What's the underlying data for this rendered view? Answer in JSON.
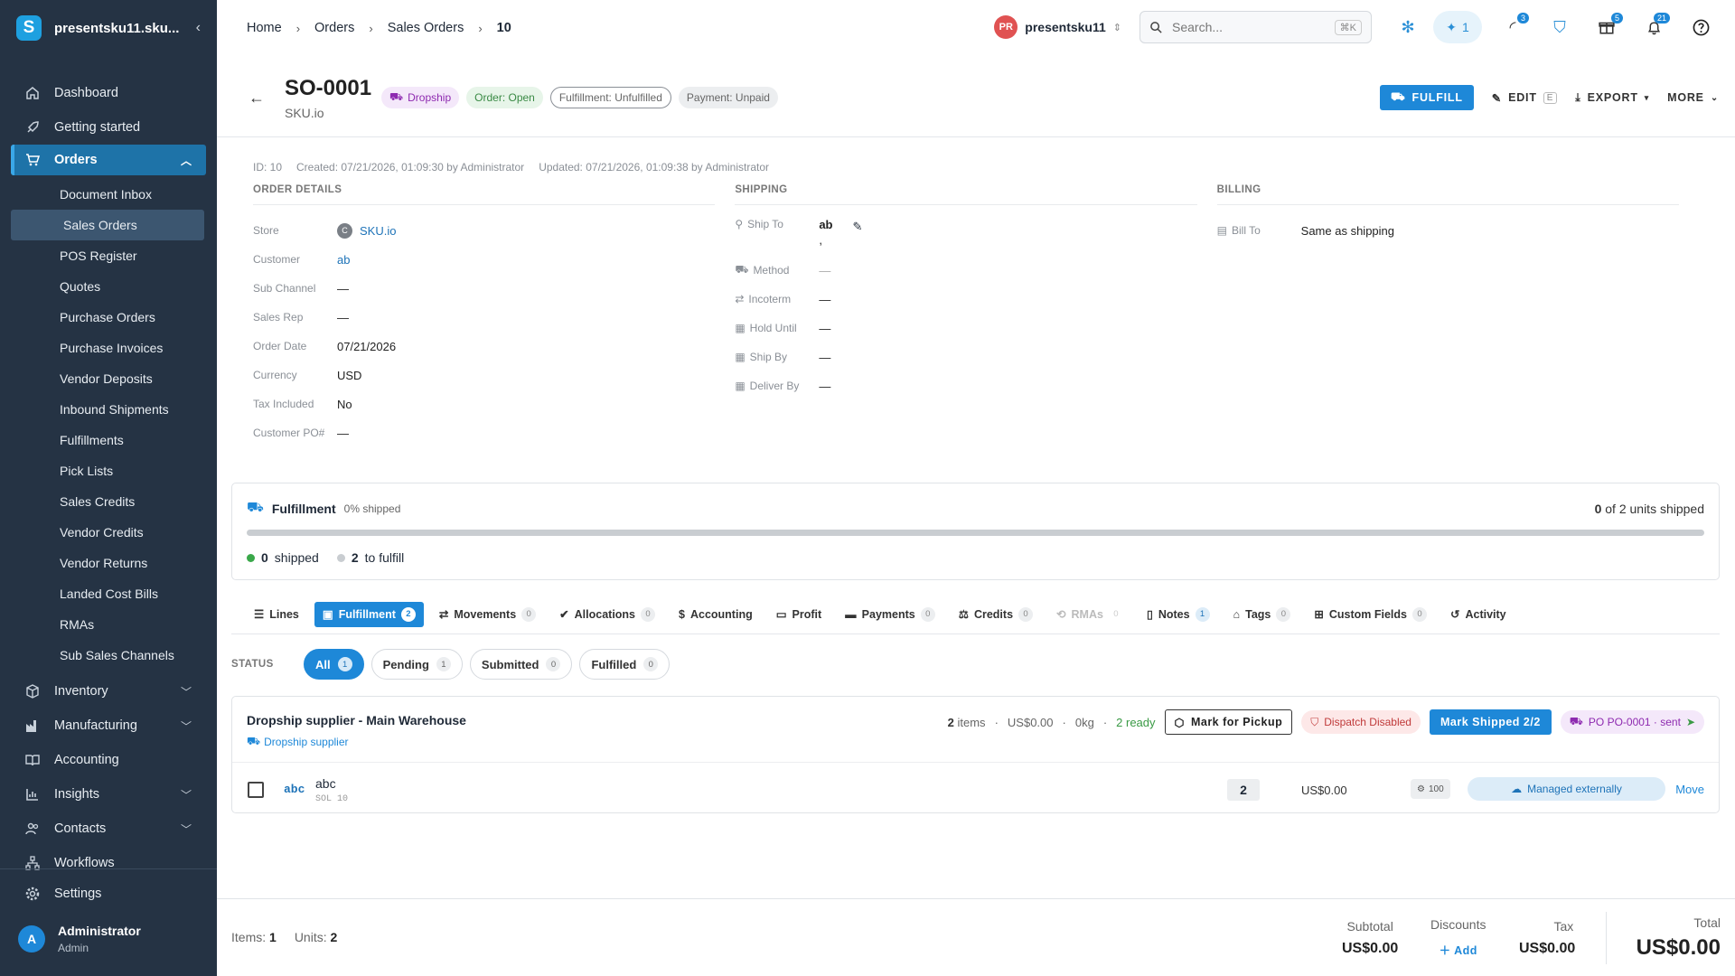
{
  "sidebar": {
    "app_title": "presentsku11.sku...",
    "items": [
      {
        "label": "Dashboard",
        "icon": "home-icon"
      },
      {
        "label": "Getting started",
        "icon": "rocket-icon"
      },
      {
        "label": "Orders",
        "icon": "cart-icon"
      }
    ],
    "order_sub": [
      "Document Inbox",
      "Sales Orders",
      "POS Register",
      "Quotes",
      "Purchase Orders",
      "Purchase Invoices",
      "Vendor Deposits",
      "Inbound Shipments",
      "Fulfillments",
      "Pick Lists",
      "Sales Credits",
      "Vendor Credits",
      "Vendor Returns",
      "Landed Cost Bills",
      "RMAs",
      "Sub Sales Channels"
    ],
    "lower": [
      {
        "label": "Inventory",
        "icon": "box-icon"
      },
      {
        "label": "Manufacturing",
        "icon": "factory-icon"
      },
      {
        "label": "Accounting",
        "icon": "book-icon"
      },
      {
        "label": "Insights",
        "icon": "chart-icon"
      },
      {
        "label": "Contacts",
        "icon": "people-icon"
      },
      {
        "label": "Workflows",
        "icon": "workflow-icon"
      }
    ],
    "settings": "Settings",
    "user": {
      "initial": "A",
      "name": "Administrator",
      "role": "Admin"
    }
  },
  "breadcrumb": [
    "Home",
    "Orders",
    "Sales Orders",
    "10"
  ],
  "topbar": {
    "store_initials": "PR",
    "store_name": "presentsku11",
    "search_placeholder": "Search...",
    "search_shortcut": "⌘K",
    "ai_count": "1",
    "badges": {
      "activity": "3",
      "gifts": "5",
      "notifications": "21"
    }
  },
  "order": {
    "number": "SO-0001",
    "store": "SKU.io",
    "chips": {
      "dropship": "Dropship",
      "order": "Order: Open",
      "fulfillment": "Fulfillment: Unfulfilled",
      "payment": "Payment: Unpaid"
    },
    "actions": {
      "fulfill": "FULFILL",
      "edit": "EDIT",
      "edit_key": "E",
      "export": "EXPORT",
      "more": "MORE"
    },
    "meta": {
      "id": "ID: 10",
      "created": "Created: 07/21/2026, 01:09:30 by Administrator",
      "updated": "Updated: 07/21/2026, 01:09:38 by Administrator"
    }
  },
  "details": {
    "order_header": "ORDER DETAILS",
    "order_rows": [
      {
        "label": "Store",
        "value": "SKU.io"
      },
      {
        "label": "Customer",
        "value": "ab"
      },
      {
        "label": "Sub Channel",
        "value": "—"
      },
      {
        "label": "Sales Rep",
        "value": "—"
      },
      {
        "label": "Order Date",
        "value": "07/21/2026"
      },
      {
        "label": "Currency",
        "value": "USD"
      },
      {
        "label": "Tax Included",
        "value": "No"
      },
      {
        "label": "Customer PO#",
        "value": "—"
      }
    ],
    "store_initial": "C",
    "shipping_header": "SHIPPING",
    "ship_rows": [
      {
        "label": "Ship To",
        "value": "ab",
        "extra": ","
      },
      {
        "label": "Method",
        "value": "—"
      },
      {
        "label": "Incoterm",
        "value": "—"
      },
      {
        "label": "Hold Until",
        "value": "—"
      },
      {
        "label": "Ship By",
        "value": "—"
      },
      {
        "label": "Deliver By",
        "value": "—"
      }
    ],
    "billing_header": "BILLING",
    "bill_label": "Bill To",
    "bill_value": "Same as shipping"
  },
  "fulfillment": {
    "title": "Fulfillment",
    "pct_label": "0% shipped",
    "shipped_fraction": 0,
    "shipped_units": "0",
    "units_suffix": "of 2 units shipped",
    "shipped_count": "0",
    "shipped_label": "shipped",
    "to_fulfill_count": "2",
    "to_fulfill_label": "to fulfill",
    "colors": {
      "shipped": "#3aa84a",
      "to_fulfill": "#c9cdd1"
    }
  },
  "tabs": [
    {
      "label": "Lines",
      "icon": "list-icon"
    },
    {
      "label": "Fulfillment",
      "count": "2",
      "icon": "clipboard-icon",
      "active": true
    },
    {
      "label": "Movements",
      "count": "0",
      "icon": "arrows-icon"
    },
    {
      "label": "Allocations",
      "count": "0",
      "icon": "check-circle-icon"
    },
    {
      "label": "Accounting",
      "icon": "dollar-icon"
    },
    {
      "label": "Profit",
      "icon": "cash-icon"
    },
    {
      "label": "Payments",
      "count": "0",
      "icon": "card-icon"
    },
    {
      "label": "Credits",
      "count": "0",
      "icon": "credit-icon"
    },
    {
      "label": "RMAs",
      "count": "0",
      "icon": "rma-icon",
      "disabled": true
    },
    {
      "label": "Notes",
      "count": "1",
      "icon": "note-icon"
    },
    {
      "label": "Tags",
      "count": "0",
      "icon": "tag-icon"
    },
    {
      "label": "Custom Fields",
      "count": "0",
      "icon": "fields-icon"
    },
    {
      "label": "Activity",
      "icon": "history-icon"
    }
  ],
  "status": {
    "label": "STATUS",
    "filters": [
      {
        "label": "All",
        "count": "1",
        "active": true
      },
      {
        "label": "Pending",
        "count": "1"
      },
      {
        "label": "Submitted",
        "count": "0"
      },
      {
        "label": "Fulfilled",
        "count": "0"
      }
    ]
  },
  "supplier": {
    "title": "Dropship supplier - Main Warehouse",
    "sub": "Dropship supplier",
    "items_count": "2",
    "items_word": "items",
    "amount": "US$0.00",
    "weight": "0kg",
    "ready": "2 ready",
    "pickup_btn": "Mark for Pickup",
    "dispatch": "Dispatch Disabled",
    "ship_btn": "Mark Shipped 2/2",
    "po": "PO PO-0001 · sent",
    "line": {
      "sku": "abc",
      "name": "abc",
      "meta": "SOL 10",
      "qty": "2",
      "price": "US$0.00",
      "stock": "100",
      "managed": "Managed externally",
      "move": "Move"
    }
  },
  "footer": {
    "items_label": "Items:",
    "items": "1",
    "units_label": "Units:",
    "units": "2",
    "subtotal_label": "Subtotal",
    "subtotal": "US$0.00",
    "discounts_label": "Discounts",
    "discounts_add": "Add",
    "tax_label": "Tax",
    "tax": "US$0.00",
    "total_label": "Total",
    "total": "US$0.00"
  }
}
